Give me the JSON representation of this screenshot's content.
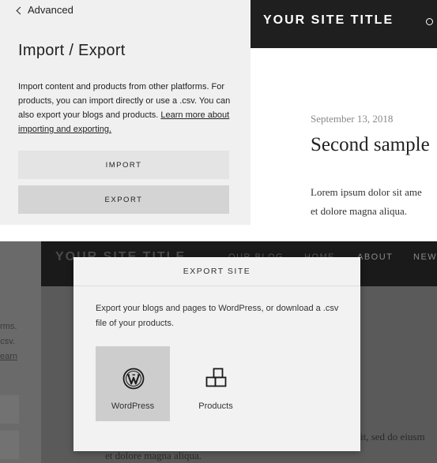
{
  "top": {
    "back_label": "Advanced",
    "title": "Import / Export",
    "description": "Import content and products from other platforms. For products, you can import directly or use a .csv. You can also export your blogs and products. ",
    "learn_link": "Learn more about importing and exporting.",
    "import_label": "IMPORT",
    "export_label": "EXPORT",
    "site": {
      "title": "YOUR SITE TITLE",
      "post_date": "September 13, 2018",
      "post_title": "Second sample",
      "post_line1": "Lorem ipsum dolor sit ame",
      "post_line2": "et dolore magna aliqua."
    }
  },
  "bottom": {
    "bg_left_lines": [
      "rms.",
      "csv.",
      "earn"
    ],
    "bg_site_title": "YOUR SITE TITLE",
    "bg_nav": [
      "OUR BLOG",
      "HOME",
      "ABOUT",
      "NEW"
    ],
    "bg_body_line1": "it, sed do eiusm",
    "bg_body_line2": "et dolore magna aliqua.",
    "modal": {
      "title": "EXPORT SITE",
      "description": "Export your blogs and pages to WordPress, or download a .csv file of your products.",
      "options": [
        {
          "label": "WordPress",
          "icon": "wordpress-icon",
          "selected": true
        },
        {
          "label": "Products",
          "icon": "products-icon",
          "selected": false
        }
      ]
    }
  }
}
